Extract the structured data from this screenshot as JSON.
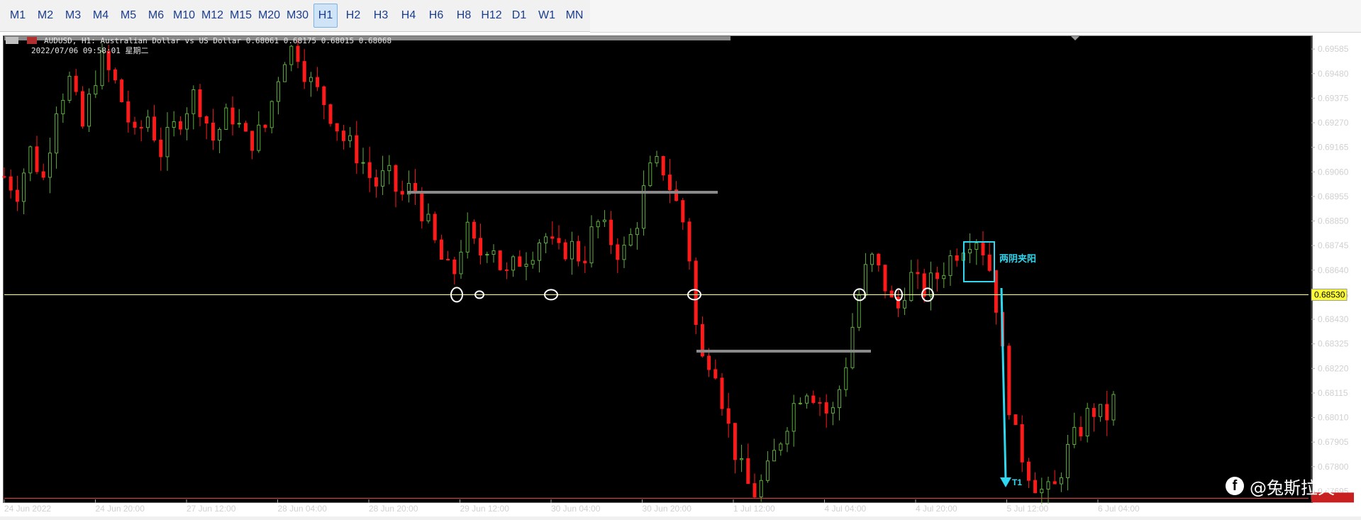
{
  "toolbar": {
    "timeframes": [
      "M1",
      "M2",
      "M3",
      "M4",
      "M5",
      "M6",
      "M10",
      "M12",
      "M15",
      "M20",
      "M30",
      "H1",
      "H2",
      "H3",
      "H4",
      "H6",
      "H8",
      "H12",
      "D1",
      "W1",
      "MN"
    ],
    "active": "H1"
  },
  "chart": {
    "symbol_line": "AUDUSD, H1:  Australian Dollar vs US Dollar  0.68061 0.68175 0.68015 0.68068",
    "datetime_line": "2022/07/06  09:58:01  星期二",
    "current_price": "0.68530",
    "annotation": "两阴夹阳",
    "target_label": "T1",
    "colors": {
      "bull": "#5fae3f",
      "bear": "#ff1a1a",
      "level": "#f3f99a",
      "support": "#c84040",
      "gray_line": "#8a8a8a",
      "cyan": "#2ed8f0",
      "circle": "#ffffff"
    }
  },
  "chart_data": {
    "type": "candlestick",
    "price_axis_ticks": [
      "0.69585",
      "0.69480",
      "0.69375",
      "0.69270",
      "0.69165",
      "0.69060",
      "0.68955",
      "0.68850",
      "0.68745",
      "0.68640",
      "0.68535",
      "0.68430",
      "0.68325",
      "0.68220",
      "0.68115",
      "0.68010",
      "0.67905",
      "0.67800",
      "0.67695"
    ],
    "time_axis_labels": [
      "24 Jun 2022",
      "24 Jun 20:00",
      "27 Jun 12:00",
      "28 Jun 04:00",
      "28 Jun 20:00",
      "29 Jun 12:00",
      "30 Jun 04:00",
      "30 Jun 20:00",
      "1 Jul 12:00",
      "4 Jul 04:00",
      "4 Jul 20:00",
      "5 Jul 12:00",
      "6 Jul 04:00"
    ],
    "ylim": [
      0.6766,
      0.6964
    ],
    "key_level": 0.68535,
    "support_level": 0.67665,
    "close_path": [
      [
        0,
        0.6904
      ],
      [
        6,
        0.6898
      ],
      [
        12,
        0.6915
      ],
      [
        18,
        0.6903
      ],
      [
        24,
        0.6935
      ],
      [
        30,
        0.6945
      ],
      [
        36,
        0.6925
      ],
      [
        44,
        0.6955
      ],
      [
        52,
        0.6942
      ],
      [
        60,
        0.692
      ],
      [
        66,
        0.693
      ],
      [
        72,
        0.6915
      ],
      [
        80,
        0.6928
      ],
      [
        88,
        0.694
      ],
      [
        96,
        0.692
      ],
      [
        104,
        0.6932
      ],
      [
        112,
        0.6918
      ],
      [
        120,
        0.6925
      ],
      [
        128,
        0.6955
      ],
      [
        134,
        0.696
      ],
      [
        140,
        0.6945
      ],
      [
        148,
        0.6935
      ],
      [
        156,
        0.692
      ],
      [
        164,
        0.6912
      ],
      [
        170,
        0.69
      ],
      [
        176,
        0.6905
      ],
      [
        182,
        0.6895
      ],
      [
        188,
        0.69
      ],
      [
        194,
        0.6885
      ],
      [
        200,
        0.687
      ],
      [
        206,
        0.686
      ],
      [
        212,
        0.6882
      ],
      [
        218,
        0.687
      ],
      [
        224,
        0.6878
      ],
      [
        230,
        0.686
      ],
      [
        236,
        0.6868
      ],
      [
        242,
        0.6872
      ],
      [
        248,
        0.688
      ],
      [
        254,
        0.687
      ],
      [
        260,
        0.6875
      ],
      [
        266,
        0.6868
      ],
      [
        272,
        0.6885
      ],
      [
        278,
        0.6878
      ],
      [
        284,
        0.687
      ],
      [
        290,
        0.6882
      ],
      [
        296,
        0.6905
      ],
      [
        302,
        0.691
      ],
      [
        308,
        0.6895
      ],
      [
        314,
        0.688
      ],
      [
        318,
        0.684
      ],
      [
        320,
        0.6825
      ],
      [
        326,
        0.6828
      ],
      [
        332,
        0.68
      ],
      [
        338,
        0.678
      ],
      [
        344,
        0.6768
      ],
      [
        350,
        0.6775
      ],
      [
        356,
        0.679
      ],
      [
        362,
        0.6805
      ],
      [
        368,
        0.6815
      ],
      [
        374,
        0.681
      ],
      [
        380,
        0.68
      ],
      [
        386,
        0.682
      ],
      [
        392,
        0.685
      ],
      [
        398,
        0.687
      ],
      [
        404,
        0.686
      ],
      [
        410,
        0.6845
      ],
      [
        416,
        0.6862
      ],
      [
        422,
        0.6855
      ],
      [
        428,
        0.686
      ],
      [
        434,
        0.6868
      ],
      [
        440,
        0.6875
      ],
      [
        446,
        0.688
      ],
      [
        452,
        0.687
      ],
      [
        456,
        0.685
      ],
      [
        460,
        0.682
      ],
      [
        464,
        0.6795
      ],
      [
        470,
        0.678
      ],
      [
        476,
        0.677
      ],
      [
        482,
        0.6768
      ],
      [
        488,
        0.6785
      ],
      [
        494,
        0.6795
      ],
      [
        500,
        0.6805
      ],
      [
        506,
        0.68
      ],
      [
        510,
        0.6808
      ]
    ],
    "total_steps": 510
  }
}
